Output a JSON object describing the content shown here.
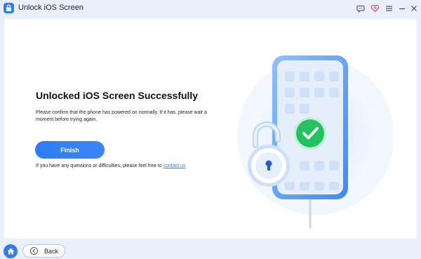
{
  "window": {
    "title": "Unlock iOS Screen",
    "controls": [
      "feedback-icon",
      "heart-icon",
      "menu-icon",
      "minimize-icon",
      "close-icon"
    ]
  },
  "main": {
    "headline": "Unlocked iOS Screen Successfully",
    "description": "Please confirm that the phone has powered on normally. If it has, please wait a moment before trying again.",
    "finish_label": "Finish",
    "help_text": "If you have any questions or difficulties, please feel free to",
    "help_link": "contact us"
  },
  "footer": {
    "back_label": "Back"
  },
  "colors": {
    "accent": "#2e7cf6",
    "success": "#22c35e",
    "background": "#e9f0fb"
  }
}
